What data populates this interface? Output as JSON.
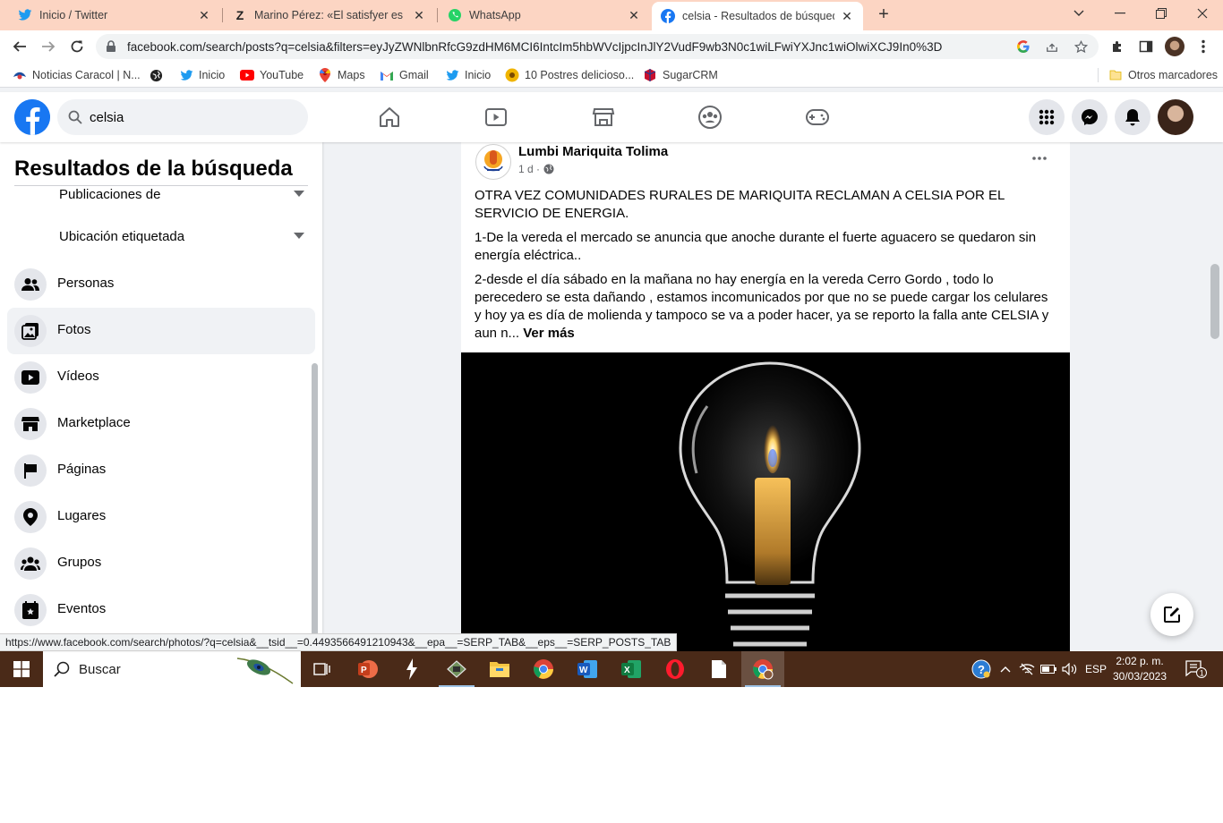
{
  "browser": {
    "tabs": [
      {
        "title": "Inicio / Twitter",
        "icon": "twitter-icon"
      },
      {
        "title": "Marino Pérez: «El satisfyer es la c",
        "icon": "z-logo-icon"
      },
      {
        "title": "WhatsApp",
        "icon": "whatsapp-icon"
      },
      {
        "title": "celsia - Resultados de búsqueda",
        "icon": "facebook-icon",
        "active": true
      }
    ],
    "url": "facebook.com/search/posts?q=celsia&filters=eyJyZWNlbnRfcG9zdHM6MCI6IntcIm5hbWVcIjpcInJlY2VudF9wb3N0c1wiLFwiYXJnc1wiOlwiXCJ9In0%3D",
    "bookmarks": [
      {
        "label": "Noticias Caracol | N...",
        "icon": "caracol-icon"
      },
      {
        "label": "",
        "icon": "globe-icon"
      },
      {
        "label": "Inicio",
        "icon": "twitter-icon"
      },
      {
        "label": "YouTube",
        "icon": "youtube-icon"
      },
      {
        "label": "Maps",
        "icon": "maps-pin-icon"
      },
      {
        "label": "Gmail",
        "icon": "gmail-icon"
      },
      {
        "label": "Inicio",
        "icon": "twitter-icon"
      },
      {
        "label": "10 Postres delicioso...",
        "icon": "dessert-icon"
      },
      {
        "label": "SugarCRM",
        "icon": "sugarcrm-icon"
      }
    ],
    "other_bookmarks": "Otros marcadores",
    "status_url": "https://www.facebook.com/search/photos/?q=celsia&__tsid__=0.4493566491210943&__epa__=SERP_TAB&__eps__=SERP_POSTS_TAB"
  },
  "facebook": {
    "search_value": "celsia",
    "sidebar": {
      "title": "Resultados de la búsqueda",
      "filters": [
        {
          "label": "Publicaciones de"
        },
        {
          "label": "Ubicación etiquetada"
        }
      ],
      "items": [
        {
          "label": "Personas",
          "icon": "people-icon"
        },
        {
          "label": "Fotos",
          "icon": "photos-icon",
          "active": true
        },
        {
          "label": "Vídeos",
          "icon": "video-play-icon"
        },
        {
          "label": "Marketplace",
          "icon": "store-icon"
        },
        {
          "label": "Páginas",
          "icon": "flag-icon"
        },
        {
          "label": "Lugares",
          "icon": "location-pin-icon"
        },
        {
          "label": "Grupos",
          "icon": "groups-icon"
        },
        {
          "label": "Eventos",
          "icon": "calendar-star-icon"
        }
      ]
    },
    "post": {
      "author": "Lumbi Mariquita Tolima",
      "time": "1 d ·",
      "paragraphs": [
        "OTRA VEZ COMUNIDADES RURALES DE MARIQUITA RECLAMAN A CELSIA POR EL SERVICIO DE ENERGIA.",
        "1-De la vereda el mercado se anuncia que anoche durante el fuerte aguacero se quedaron sin energía eléctrica..",
        "2-desde el día sábado en la mañana no hay energía en la vereda Cerro Gordo , todo lo perecedero se esta dañando , estamos  incomunicados por que no se puede cargar los celulares y hoy ya es día de molienda y tampoco se va a poder hacer, ya se reporto la falla ante CELSIA y aun n..."
      ],
      "see_more": "Ver más"
    }
  },
  "taskbar": {
    "search_label": "Buscar",
    "language": "ESP",
    "time": "2:02 p. m.",
    "date": "30/03/2023",
    "notification_count": "1"
  }
}
